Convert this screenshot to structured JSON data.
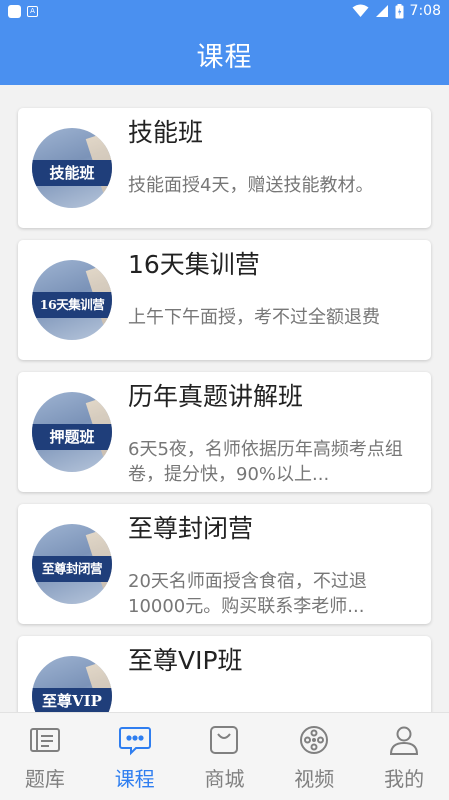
{
  "status_bar": {
    "time": "7:08",
    "notification_badge": "A"
  },
  "header": {
    "title": "课程"
  },
  "courses": [
    {
      "thumb_text": "技能班",
      "title": "技能班",
      "desc": "技能面授4天，赠送技能教材。"
    },
    {
      "thumb_text": "16天集训营",
      "title": "16天集训营",
      "desc": "上午下午面授，考不过全额退费"
    },
    {
      "thumb_text": "押题班",
      "title": "历年真题讲解班",
      "desc": "6天5夜，名师依据历年高频考点组卷，提分快，90%以上..."
    },
    {
      "thumb_text": "至尊封闭营",
      "title": "至尊封闭营",
      "desc": "20天名师面授含食宿，不过退10000元。购买联系李老师..."
    },
    {
      "thumb_text": "至尊VIP",
      "title": "至尊VIP班",
      "desc": ""
    }
  ],
  "tabs": [
    {
      "label": "题库",
      "icon": "question-bank-icon"
    },
    {
      "label": "课程",
      "icon": "chat-bubble-icon"
    },
    {
      "label": "商城",
      "icon": "shopping-bag-icon"
    },
    {
      "label": "视频",
      "icon": "film-reel-icon"
    },
    {
      "label": "我的",
      "icon": "user-icon"
    }
  ],
  "active_tab": "课程",
  "colors": {
    "primary": "#4a90f0",
    "active_tab": "#2f7ef0",
    "inactive_tab": "#808080"
  }
}
